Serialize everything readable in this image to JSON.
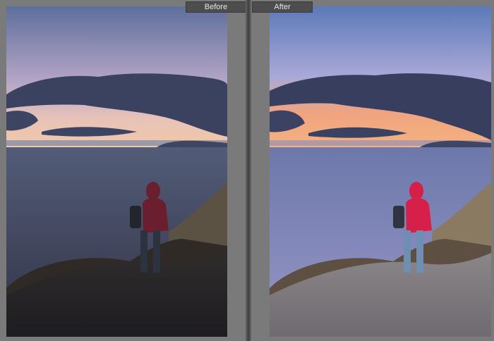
{
  "comparison": {
    "before_label": "Before",
    "after_label": "After"
  },
  "colors": {
    "background": "#7a7a7a",
    "tab_background": "#4d4d4d",
    "tab_text": "#e6e6e6"
  }
}
